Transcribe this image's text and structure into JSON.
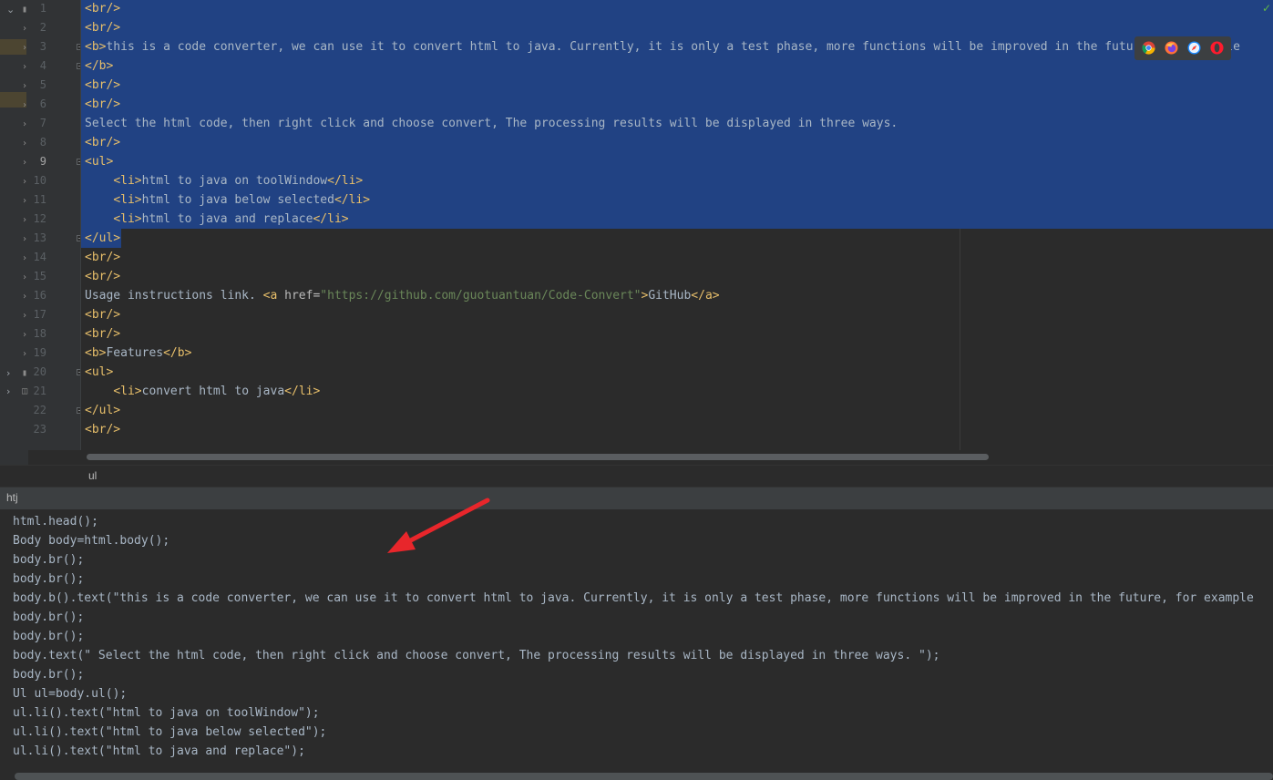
{
  "editor": {
    "line_numbers": [
      "1",
      "2",
      "3",
      "4",
      "5",
      "6",
      "7",
      "8",
      "9",
      "10",
      "11",
      "12",
      "13",
      "14",
      "15",
      "16",
      "17",
      "18",
      "19",
      "20",
      "21",
      "22",
      "23"
    ],
    "current_line": "9",
    "lines": [
      [
        {
          "t": "tag",
          "v": "<br/>"
        }
      ],
      [
        {
          "t": "tag",
          "v": "<br/>"
        }
      ],
      [
        {
          "t": "tag",
          "v": "<b>"
        },
        {
          "t": "txt",
          "v": "this is a code converter, we can use it to convert html to java. Currently, it is only a test phase, more functions will be improved in the future, for example"
        }
      ],
      [
        {
          "t": "tag",
          "v": "</b>"
        }
      ],
      [
        {
          "t": "tag",
          "v": "<br/>"
        }
      ],
      [
        {
          "t": "tag",
          "v": "<br/>"
        }
      ],
      [
        {
          "t": "txt",
          "v": "Select the html code, then right click and choose convert, The processing results will be displayed in three ways."
        }
      ],
      [
        {
          "t": "tag",
          "v": "<br/>"
        }
      ],
      [
        {
          "t": "tag",
          "v": "<ul>"
        }
      ],
      [
        {
          "t": "txt",
          "v": "    "
        },
        {
          "t": "tag",
          "v": "<li>"
        },
        {
          "t": "txt",
          "v": "html to java on toolWindow"
        },
        {
          "t": "tag",
          "v": "</li>"
        }
      ],
      [
        {
          "t": "txt",
          "v": "    "
        },
        {
          "t": "tag",
          "v": "<li>"
        },
        {
          "t": "txt",
          "v": "html to java below selected"
        },
        {
          "t": "tag",
          "v": "</li>"
        }
      ],
      [
        {
          "t": "txt",
          "v": "    "
        },
        {
          "t": "tag",
          "v": "<li>"
        },
        {
          "t": "txt",
          "v": "html to java and replace"
        },
        {
          "t": "tag",
          "v": "</li>"
        }
      ],
      [
        {
          "t": "tag",
          "v": "</ul>"
        }
      ],
      [
        {
          "t": "tag",
          "v": "<br/>"
        }
      ],
      [
        {
          "t": "tag",
          "v": "<br/>"
        }
      ],
      [
        {
          "t": "txt",
          "v": "Usage instructions link. "
        },
        {
          "t": "tag",
          "v": "<a "
        },
        {
          "t": "attr",
          "v": "href="
        },
        {
          "t": "str",
          "v": "\"https://github.com/guotuantuan/Code-Convert\""
        },
        {
          "t": "tag",
          "v": ">"
        },
        {
          "t": "txt",
          "v": "GitHub"
        },
        {
          "t": "tag",
          "v": "</a>"
        }
      ],
      [
        {
          "t": "tag",
          "v": "<br/>"
        }
      ],
      [
        {
          "t": "tag",
          "v": "<br/>"
        }
      ],
      [
        {
          "t": "tag",
          "v": "<b>"
        },
        {
          "t": "txt",
          "v": "Features"
        },
        {
          "t": "tag",
          "v": "</b>"
        }
      ],
      [
        {
          "t": "tag",
          "v": "<ul>"
        }
      ],
      [
        {
          "t": "txt",
          "v": "    "
        },
        {
          "t": "tag",
          "v": "<li>"
        },
        {
          "t": "txt",
          "v": "convert html to java"
        },
        {
          "t": "tag",
          "v": "</li>"
        }
      ],
      [
        {
          "t": "tag",
          "v": "</ul>"
        }
      ],
      [
        {
          "t": "tag",
          "v": "<br/>"
        }
      ]
    ]
  },
  "breadcrumb": {
    "label": "ul"
  },
  "tool_window": {
    "title": "htj",
    "output_lines": [
      "html.head();",
      "Body body=html.body();",
      "body.br();",
      "body.br();",
      "body.b().text(\"this is a code converter, we can use it to convert html to java. Currently, it is only a test phase, more functions will be improved in the future, for example",
      "body.br();",
      "body.br();",
      "body.text(\" Select the html code, then right click and choose convert, The processing results will be displayed in three ways. \");",
      "body.br();",
      "Ul ul=body.ul();",
      "ul.li().text(\"html to java on toolWindow\");",
      "ul.li().text(\"html to java below selected\");",
      "ul.li().text(\"html to java and replace\");"
    ]
  },
  "browser_icons": [
    "chrome-icon",
    "firefox-icon",
    "safari-icon",
    "opera-icon"
  ],
  "colors": {
    "selection": "#214283",
    "tag": "#e8bf6a",
    "text": "#a9b7c6",
    "string": "#6a8759",
    "arrow": "#e8262b"
  }
}
